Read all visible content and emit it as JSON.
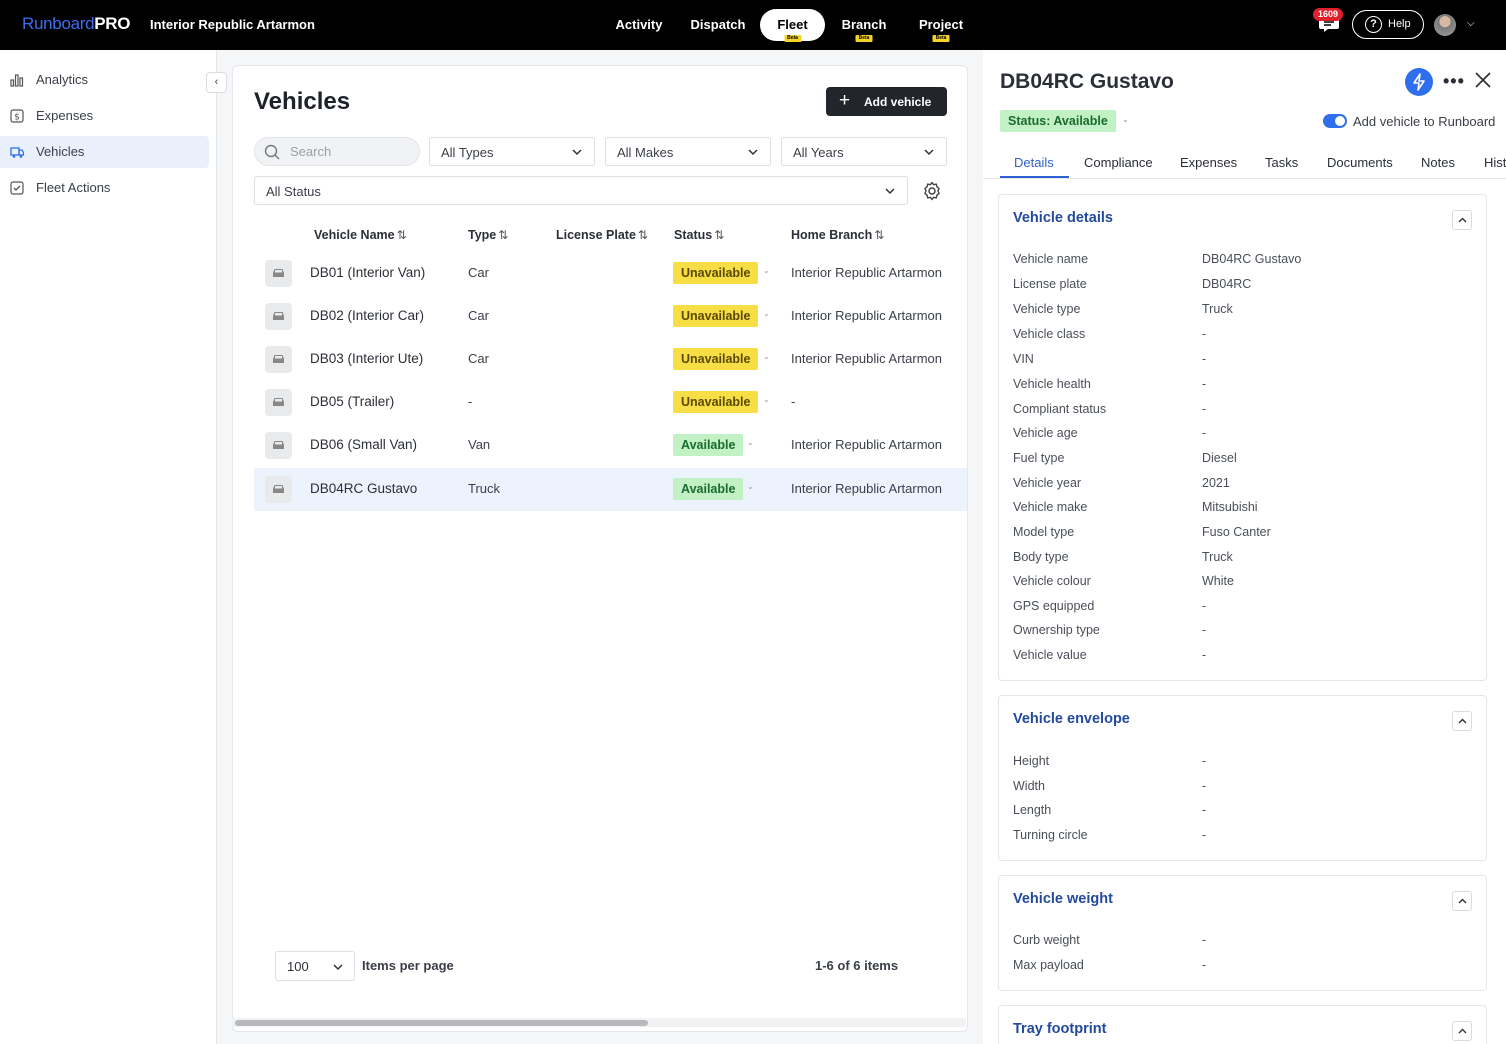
{
  "app": {
    "logo_part1": "Runboard",
    "logo_part2": "PRO",
    "org_name": "Interior Republic Artarmon"
  },
  "nav": {
    "items": [
      {
        "label": "Activity",
        "beta": false
      },
      {
        "label": "Dispatch",
        "beta": false
      },
      {
        "label": "Fleet",
        "beta": true,
        "active": true
      },
      {
        "label": "Branch",
        "beta": true
      },
      {
        "label": "Project",
        "beta": true
      }
    ],
    "beta_label": "Beta",
    "notification_count": "1609",
    "help_label": "Help"
  },
  "sidebar": {
    "items": [
      {
        "label": "Analytics",
        "icon": "bar-chart-icon"
      },
      {
        "label": "Expenses",
        "icon": "dollar-icon"
      },
      {
        "label": "Vehicles",
        "icon": "truck-icon",
        "active": true
      },
      {
        "label": "Fleet Actions",
        "icon": "checkbox-icon"
      }
    ]
  },
  "list": {
    "title": "Vehicles",
    "add_button": "Add vehicle",
    "search_placeholder": "Search",
    "filters": {
      "types": "All Types",
      "makes": "All Makes",
      "years": "All Years",
      "status": "All Status"
    },
    "columns": [
      "Vehicle Name",
      "Type",
      "License Plate",
      "Status",
      "Home Branch"
    ],
    "rows": [
      {
        "name": "DB01 (Interior Van)",
        "type": "Car",
        "plate": "",
        "status": "Unavailable",
        "branch": "Interior Republic Artarmon"
      },
      {
        "name": "DB02 (Interior Car)",
        "type": "Car",
        "plate": "",
        "status": "Unavailable",
        "branch": "Interior Republic Artarmon"
      },
      {
        "name": "DB03 (Interior Ute)",
        "type": "Car",
        "plate": "",
        "status": "Unavailable",
        "branch": "Interior Republic Artarmon"
      },
      {
        "name": "DB05 (Trailer)",
        "type": "-",
        "plate": "",
        "status": "Unavailable",
        "branch": "-"
      },
      {
        "name": "DB06 (Small Van)",
        "type": "Van",
        "plate": "",
        "status": "Available",
        "branch": "Interior Republic Artarmon"
      },
      {
        "name": "DB04RC Gustavo",
        "type": "Truck",
        "plate": "",
        "status": "Available",
        "branch": "Interior Republic Artarmon",
        "selected": true
      }
    ],
    "per_page": "100",
    "per_page_label": "Items per page",
    "range_label": "1-6 of 6 items"
  },
  "detail": {
    "title": "DB04RC Gustavo",
    "status": "Status: Available",
    "toggle_label": "Add vehicle to Runboard",
    "toggle_on": true,
    "tabs": [
      "Details",
      "Compliance",
      "Expenses",
      "Tasks",
      "Documents",
      "Notes",
      "Hist"
    ],
    "sections": {
      "details": {
        "title": "Vehicle details",
        "fields": [
          {
            "label": "Vehicle name",
            "value": "DB04RC Gustavo"
          },
          {
            "label": "License plate",
            "value": "DB04RC"
          },
          {
            "label": "Vehicle type",
            "value": "Truck"
          },
          {
            "label": "Vehicle class",
            "value": "-"
          },
          {
            "label": "VIN",
            "value": "-"
          },
          {
            "label": "Vehicle health",
            "value": "-"
          },
          {
            "label": "Compliant status",
            "value": "-"
          },
          {
            "label": "Vehicle age",
            "value": "-"
          },
          {
            "label": "Fuel type",
            "value": "Diesel"
          },
          {
            "label": "Vehicle year",
            "value": "2021"
          },
          {
            "label": "Vehicle make",
            "value": "Mitsubishi"
          },
          {
            "label": "Model type",
            "value": "Fuso Canter"
          },
          {
            "label": "Body type",
            "value": "Truck"
          },
          {
            "label": "Vehicle colour",
            "value": "White"
          },
          {
            "label": "GPS equipped",
            "value": "-"
          },
          {
            "label": "Ownership type",
            "value": "-"
          },
          {
            "label": "Vehicle value",
            "value": "-"
          }
        ]
      },
      "envelope": {
        "title": "Vehicle envelope",
        "fields": [
          {
            "label": "Height",
            "value": "-"
          },
          {
            "label": "Width",
            "value": "-"
          },
          {
            "label": "Length",
            "value": "-"
          },
          {
            "label": "Turning circle",
            "value": "-"
          }
        ]
      },
      "weight": {
        "title": "Vehicle weight",
        "fields": [
          {
            "label": "Curb weight",
            "value": "-"
          },
          {
            "label": "Max payload",
            "value": "-"
          }
        ]
      },
      "tray": {
        "title": "Tray footprint"
      }
    }
  },
  "colors": {
    "accent": "#2f6fed",
    "unavailable": "#f7de45",
    "available": "#c2f1c6",
    "section_title": "#234a9e"
  }
}
